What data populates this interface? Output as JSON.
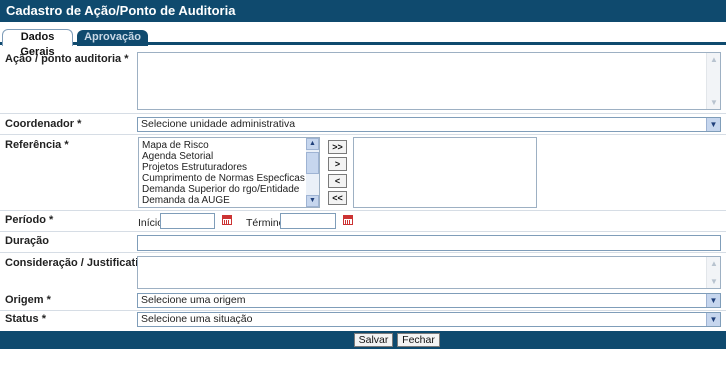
{
  "window": {
    "title": "Cadastro de Ação/Ponto de Auditoria"
  },
  "tabs": [
    {
      "label": "Dados Gerais",
      "active": true
    },
    {
      "label": "Aprovação",
      "active": false
    }
  ],
  "required_marker": "*",
  "fields": {
    "acao": {
      "label": "Ação / ponto auditoria",
      "value": ""
    },
    "coordenador": {
      "label": "Coordenador",
      "selected": "Selecione unidade administrativa"
    },
    "referencia": {
      "label": "Referência",
      "options": [
        "Mapa de Risco",
        "Agenda Setorial",
        "Projetos Estruturadores",
        "Cumprimento de Normas Especficas",
        "Demanda Superior do rgo/Entidade",
        "Demanda da AUGE"
      ],
      "selected": [],
      "move_buttons": [
        ">>",
        ">",
        "<",
        "<<"
      ]
    },
    "periodo": {
      "label": "Período",
      "inicio_label": "Início",
      "termino_label": "Término",
      "inicio": "",
      "termino": ""
    },
    "duracao": {
      "label": "Duração",
      "value": ""
    },
    "consideracao": {
      "label": "Consideração / Justificativa",
      "value": ""
    },
    "origem": {
      "label": "Origem",
      "selected": "Selecione uma origem"
    },
    "status": {
      "label": "Status",
      "selected": "Selecione uma situação"
    }
  },
  "footer": {
    "save_label": "Salvar",
    "close_label": "Fechar"
  },
  "colors": {
    "header": "#0f4a6e",
    "border": "#7f9db9",
    "calendar": "#cc3333"
  }
}
